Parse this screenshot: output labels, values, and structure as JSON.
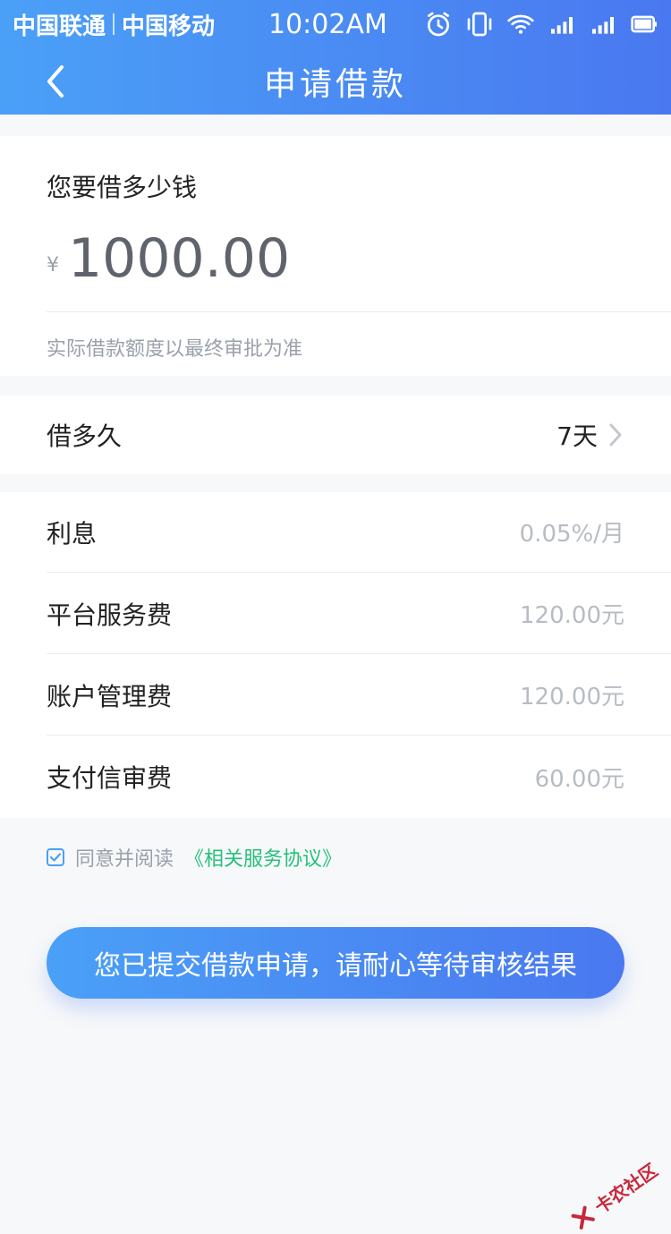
{
  "status_bar": {
    "carrier1": "中国联通",
    "carrier2": "中国移动",
    "time": "10:02AM"
  },
  "navbar": {
    "title": "申请借款",
    "back_icon": "back-arrow-icon"
  },
  "amount_section": {
    "label": "您要借多少钱",
    "currency": "¥",
    "amount": "1000.00",
    "hint": "实际借款额度以最终审批为准"
  },
  "term_section": {
    "label": "借多久",
    "value": "7天"
  },
  "fees": [
    {
      "label": "利息",
      "value": "0.05%/月"
    },
    {
      "label": "平台服务费",
      "value": "120.00元"
    },
    {
      "label": "账户管理费",
      "value": "120.00元"
    },
    {
      "label": "支付信审费",
      "value": "60.00元"
    }
  ],
  "agreement": {
    "text": "同意并阅读",
    "link": "《相关服务协议》"
  },
  "submit": {
    "label": "您已提交借款申请，请耐心等待审核结果"
  },
  "watermark": {
    "text": "卡农社区"
  },
  "colors": {
    "accent_start": "#4aa0f7",
    "accent_end": "#4a78f0",
    "link_green": "#27c07a",
    "muted": "#9aa1ab"
  }
}
